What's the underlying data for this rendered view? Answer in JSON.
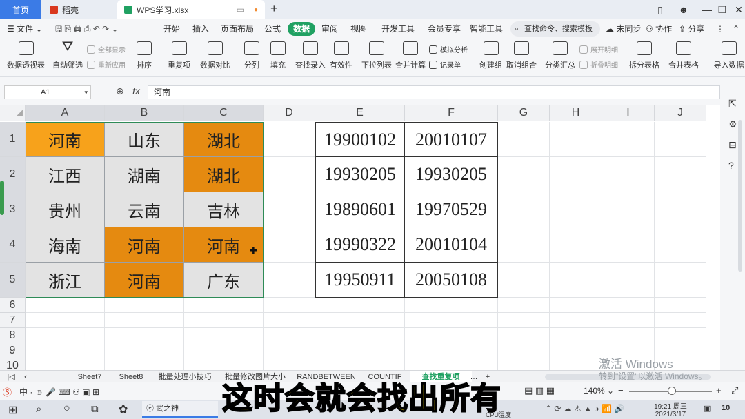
{
  "titlebar": {
    "home_tab": "首页",
    "tab2": "稻壳",
    "file_tab": "WPS学习.xlsx"
  },
  "menu": {
    "file": "文件",
    "items": [
      "开始",
      "插入",
      "页面布局",
      "公式",
      "数据",
      "审阅",
      "视图",
      "开发工具",
      "会员专享",
      "智能工具"
    ],
    "active": "数据",
    "search": "查找命令、搜索模板",
    "unsync": "未同步",
    "collab": "协作",
    "share": "分享"
  },
  "toolbar": {
    "pivot": "数据透视表",
    "autofilter": "自动筛选",
    "show_all": "全部显示",
    "reapply": "重新应用",
    "sort": "排序",
    "dup": "重复项",
    "compare": "数据对比",
    "split": "分列",
    "fill": "填充",
    "find_entry": "查找录入",
    "validity": "有效性",
    "dropdown": "下拉列表",
    "consolidate": "合并计算",
    "simulate": "模拟分析",
    "record": "记录单",
    "group": "创建组",
    "ungroup": "取消组合",
    "subtotal": "分类汇总",
    "expand": "展开明细",
    "collapse": "折叠明细",
    "split_table": "拆分表格",
    "merge_table": "合并表格",
    "import": "导入数据"
  },
  "formula": {
    "cell_ref": "A1",
    "fx": "fx",
    "value": "河南"
  },
  "columns": [
    "A",
    "B",
    "C",
    "D",
    "E",
    "F",
    "G",
    "H",
    "I",
    "J"
  ],
  "rows": [
    "1",
    "2",
    "3",
    "4",
    "5",
    "6",
    "7",
    "8",
    "9",
    "10"
  ],
  "table_abc": [
    [
      "河南",
      "山东",
      "湖北"
    ],
    [
      "江西",
      "湖南",
      "湖北"
    ],
    [
      "贵州",
      "云南",
      "吉林"
    ],
    [
      "海南",
      "河南",
      "河南"
    ],
    [
      "浙江",
      "河南",
      "广东"
    ]
  ],
  "table_ef": [
    [
      "19900102",
      "20010107"
    ],
    [
      "19930205",
      "19930205"
    ],
    [
      "19890601",
      "19970529"
    ],
    [
      "19990322",
      "20010104"
    ],
    [
      "19950911",
      "20050108"
    ]
  ],
  "sheets": [
    "Sheet7",
    "Sheet8",
    "批量处理小技巧",
    "批量修改图片大小",
    "RANDBETWEEN",
    "COUNTIF",
    "查找重复项"
  ],
  "active_sheet": "查找重复项",
  "status": {
    "zoom": "140%"
  },
  "watermark": {
    "line1": "激活 Windows",
    "line2": "转到\"设置\"以激活 Windows。"
  },
  "subtitle": "这时会就会找出所有",
  "taskbar": {
    "app": "武之神",
    "cpu": "CPU温度",
    "time": "19:21 周三",
    "date": "2021/3/17",
    "badge": "10"
  },
  "colors": {
    "highlight": "#e58a10",
    "active_menu": "#20a162",
    "home_tab": "#3b7be6"
  }
}
